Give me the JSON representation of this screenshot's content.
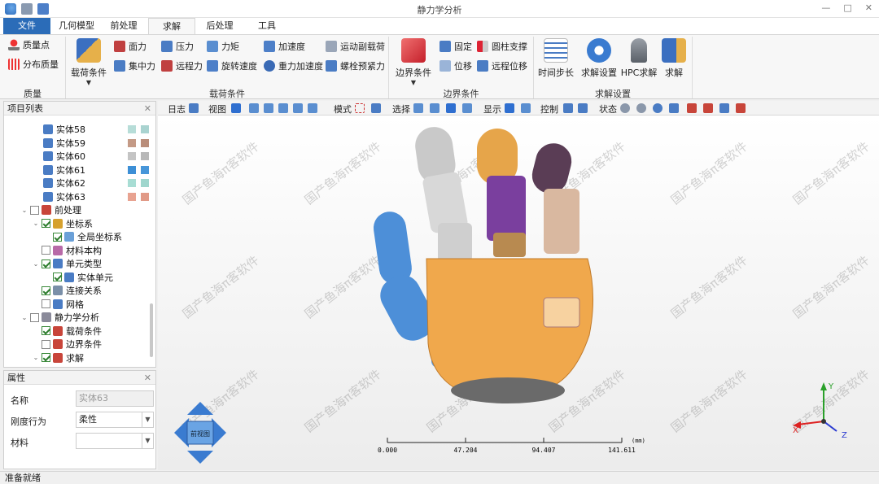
{
  "app": {
    "title": "静力学分析",
    "window_buttons": [
      "—",
      "□",
      "✕"
    ]
  },
  "tabs": [
    {
      "label": "文件"
    },
    {
      "label": "几何模型"
    },
    {
      "label": "前处理"
    },
    {
      "label": "求解"
    },
    {
      "label": "后处理"
    },
    {
      "label": "工具"
    }
  ],
  "ribbon": {
    "groups": {
      "mass": "质量",
      "loads": "载荷条件",
      "bc": "边界条件",
      "solve": "求解设置"
    },
    "mass": {
      "point_mass": "质量点",
      "distributed_mass": "分布质量"
    },
    "loads": {
      "load_condition": "载荷条件",
      "surface_force": "面力",
      "pressure": "压力",
      "moment": "力矩",
      "acceleration": "加速度",
      "joint_load": "运动副载荷",
      "concentrated_force": "集中力",
      "remote_force": "远程力",
      "rotational_velocity": "旋转速度",
      "gravity_acceleration": "重力加速度",
      "bolt_pretension": "螺栓预紧力"
    },
    "bc": {
      "boundary_condition": "边界条件",
      "fixed": "固定",
      "cylinder_support": "圆柱支撑",
      "displacement": "位移",
      "remote_displacement": "远程位移"
    },
    "solve": {
      "time_step": "时间步长",
      "solve_settings": "求解设置",
      "hpc_solve": "HPC求解",
      "solve": "求解"
    }
  },
  "tree_panel": {
    "title": "项目列表",
    "items": [
      {
        "label": "实体58",
        "swatch1": "#b7ddd8",
        "swatch2": "#a9d3d0"
      },
      {
        "label": "实体59",
        "swatch1": "#c49a86",
        "swatch2": "#b98d7a"
      },
      {
        "label": "实体60",
        "swatch1": "#c4c4c4",
        "swatch2": "#b8b8b8"
      },
      {
        "label": "实体61",
        "swatch1": "#3d8fd6",
        "swatch2": "#4796d9"
      },
      {
        "label": "实体62",
        "swatch1": "#a8ddd4",
        "swatch2": "#9fd6cd"
      },
      {
        "label": "实体63",
        "swatch1": "#e8a391",
        "swatch2": "#e19a87"
      },
      {
        "label": "前处理"
      },
      {
        "label": "坐标系"
      },
      {
        "label": "全局坐标系"
      },
      {
        "label": "材料本构"
      },
      {
        "label": "单元类型"
      },
      {
        "label": "实体单元"
      },
      {
        "label": "连接关系"
      },
      {
        "label": "网格"
      },
      {
        "label": "静力学分析"
      },
      {
        "label": "载荷条件"
      },
      {
        "label": "边界条件"
      },
      {
        "label": "求解"
      }
    ]
  },
  "properties_panel": {
    "title": "属性",
    "rows": [
      {
        "label": "名称",
        "value": "实体63"
      },
      {
        "label": "刚度行为",
        "value": "柔性"
      },
      {
        "label": "材料",
        "value": ""
      }
    ]
  },
  "viewport_toolbar": {
    "log": "日志",
    "view": "视图",
    "mode": "模式",
    "select": "选择",
    "display": "显示",
    "control": "控制",
    "state": "状态"
  },
  "viewport": {
    "watermark": "国产鱼海π客软件",
    "scale_labels": [
      "0.000",
      "47.204",
      "94.407",
      "141.611"
    ],
    "scale_unit": "(mm)",
    "axis_labels": {
      "x": "X",
      "y": "Y",
      "z": "Z"
    },
    "view_cube_label": "前视图"
  },
  "status": {
    "text": "准备就绪"
  }
}
